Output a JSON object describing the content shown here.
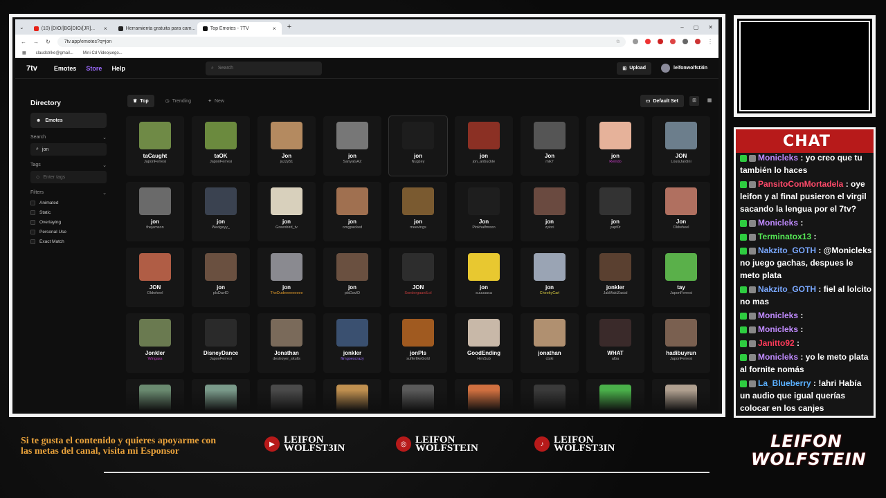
{
  "browser": {
    "tabs": [
      {
        "label": "(10) [DIO/[BG]DIO/[JR]...",
        "color": "#e62117"
      },
      {
        "label": "Herramienta gratuita para cam...",
        "color": "#222"
      },
      {
        "label": "Top Emotes - 7TV",
        "color": "#111"
      }
    ],
    "url": "7tv.app/emotes?q=jon",
    "bookmarks": [
      "claudstrike@gmail...",
      "Mini Cd Videojuego..."
    ]
  },
  "site": {
    "logo": "7tv",
    "nav": {
      "emotes": "Emotes",
      "store": "Store",
      "help": "Help"
    },
    "search_placeholder": "Search",
    "upload": "Upload",
    "username": "leifonwolfst3in"
  },
  "sidebar": {
    "heading": "Directory",
    "emotes": "Emotes",
    "search_label": "Search",
    "search_value": "jon",
    "tags_label": "Tags",
    "tags_placeholder": "Enter tags",
    "filters_label": "Filters",
    "filters": [
      "Animated",
      "Static",
      "Overlaying",
      "Personal Use",
      "Exact Match"
    ]
  },
  "toolbar": {
    "top": "Top",
    "trending": "Trending",
    "new": "New",
    "default_set": "Default Set"
  },
  "emotes": [
    {
      "name": "taCaught",
      "author": "JaponFerresi",
      "color": "#6f8a46"
    },
    {
      "name": "taOK",
      "author": "JaponFerresi",
      "color": "#6b8a3e"
    },
    {
      "name": "Jon",
      "author": "juzzy51",
      "color": "#b48a60"
    },
    {
      "name": "jon",
      "author": "SanyaGAZ",
      "color": "#777"
    },
    {
      "name": "jon",
      "author": "Nugzey",
      "color": "#1d1d1d"
    },
    {
      "name": "jon",
      "author": "jon_anbuckle",
      "color": "#8b3024"
    },
    {
      "name": "Jon",
      "author": "mik7",
      "color": "#555"
    },
    {
      "name": "jon",
      "author": "Reindo",
      "color": "#e6b29a",
      "author_color": "#c33cc3"
    },
    {
      "name": "JON",
      "author": "LouisJardini",
      "color": "#6c7e8c"
    },
    {
      "name": "jon",
      "author": "thejamson",
      "color": "#6a6a6a"
    },
    {
      "name": "jon",
      "author": "Wedgeyy_",
      "color": "#3a4250"
    },
    {
      "name": "jon",
      "author": "Greenbird_tv",
      "color": "#d8d0bc"
    },
    {
      "name": "jon",
      "author": "omgpacked",
      "color": "#a07050"
    },
    {
      "name": "jon",
      "author": "meevings",
      "color": "#7a5a30"
    },
    {
      "name": "Jon",
      "author": "Pinkhalfmoon",
      "color": "#1e1e1e"
    },
    {
      "name": "jon",
      "author": "zyiori",
      "color": "#6a4a40"
    },
    {
      "name": "jon",
      "author": "yapt0r",
      "color": "#333"
    },
    {
      "name": "Jon",
      "author": "Oldwheel",
      "color": "#b07060"
    },
    {
      "name": "JON",
      "author": "Oldwheel",
      "color": "#b05d45"
    },
    {
      "name": "jon",
      "author": "plsDavID",
      "color": "#6a5040"
    },
    {
      "name": "jon",
      "author": "TheDudeeeeeeeee",
      "color": "#8a8a90",
      "author_color": "#e09a2a"
    },
    {
      "name": "jon",
      "author": "plsDavID",
      "color": "#6a5040"
    },
    {
      "name": "JON",
      "author": "SondergaardLol",
      "color": "#2d2d2d",
      "author_color": "#c33c3c"
    },
    {
      "name": "jon",
      "author": "suuuuuca",
      "color": "#e8c830"
    },
    {
      "name": "jon",
      "author": "CheekyCarl",
      "color": "#9aa4b4",
      "author_color": "#d4c840"
    },
    {
      "name": "jonkler",
      "author": "JakMakiZasial",
      "color": "#5a4030"
    },
    {
      "name": "tay",
      "author": "JaponFerresi",
      "color": "#5ab04a"
    },
    {
      "name": "Jonkler",
      "author": "Wingass",
      "color": "#6a7a50",
      "author_color": "#c33cc3"
    },
    {
      "name": "DisneyDance",
      "author": "JaponFerresi",
      "color": "#2a2a2a"
    },
    {
      "name": "Jonathan",
      "author": "destroyer_skulls",
      "color": "#7a6a5a"
    },
    {
      "name": "jonkler",
      "author": "fiimgoescrazy",
      "color": "#3a5070",
      "author_color": "#9a6aff"
    },
    {
      "name": "jonPls",
      "author": "sufferlikeGold",
      "color": "#a05a20"
    },
    {
      "name": "GoodEnding",
      "author": "HimSub",
      "color": "#c8b8a8"
    },
    {
      "name": "jonathan",
      "author": "ctski",
      "color": "#b09070"
    },
    {
      "name": "WHAT",
      "author": "alba",
      "color": "#3a2a2a"
    },
    {
      "name": "hadibuyrun",
      "author": "JaponFerresi",
      "color": "#7a6050"
    },
    {
      "name": "",
      "author": "",
      "color": "#6a8a70"
    },
    {
      "name": "",
      "author": "",
      "color": "#7a9a8a"
    },
    {
      "name": "",
      "author": "",
      "color": "#4a4a4a"
    },
    {
      "name": "",
      "author": "",
      "color": "#c09050"
    },
    {
      "name": "",
      "author": "",
      "color": "#5a5a5a"
    },
    {
      "name": "",
      "author": "",
      "color": "#d07040"
    },
    {
      "name": "",
      "author": "",
      "color": "#3a3a3a"
    },
    {
      "name": "",
      "author": "",
      "color": "#4ab04a"
    },
    {
      "name": "",
      "author": "",
      "color": "#b0a090"
    }
  ],
  "chat": {
    "title": "CHAT",
    "messages": [
      {
        "user": "Monicleks",
        "color": "#c08bff",
        "text": ": yo creo que tu también lo haces"
      },
      {
        "user": "PansitoConMortadela",
        "color": "#ff4a6a",
        "text": ": oye leifon y al final pusieron el virgil sacando la lengua por el 7tv?"
      },
      {
        "user": "Monicleks",
        "color": "#c08bff",
        "text": ":"
      },
      {
        "user": "Terminatox13",
        "color": "#55e855",
        "text": ":"
      },
      {
        "user": "Nakzito_GOTH",
        "color": "#7aa8ff",
        "text": ": @Monicleks no juego gachas, despues le meto plata"
      },
      {
        "user": "Nakzito_GOTH",
        "color": "#7aa8ff",
        "text": ": fiel al lolcito no mas"
      },
      {
        "user": "Monicleks",
        "color": "#c08bff",
        "text": ":"
      },
      {
        "user": "Monicleks",
        "color": "#c08bff",
        "text": ":"
      },
      {
        "user": "Janitto92",
        "color": "#ff3a5a",
        "text": ":"
      },
      {
        "user": "Monicleks",
        "color": "#c08bff",
        "text": ": yo le meto plata al fornite nomás"
      },
      {
        "user": "La_Blueberry",
        "color": "#5ab0ff",
        "text": ": !ahri Había un audio que igual querías colocar en los canjes"
      }
    ]
  },
  "promo": "Si te gusta el contenido y quieres apoyarme con las metas del canal, visita mi Esponsor",
  "socials": [
    {
      "icon": "youtube-icon",
      "glyph": "▶",
      "name": "LEIFON WOLFST3IN"
    },
    {
      "icon": "instagram-icon",
      "glyph": "◎",
      "name": "LEIFON WOLFSTEIN"
    },
    {
      "icon": "tiktok-icon",
      "glyph": "♪",
      "name": "LEIFON WOLFST3IN"
    }
  ],
  "brand": "LEIFON WOLFSTEIN"
}
